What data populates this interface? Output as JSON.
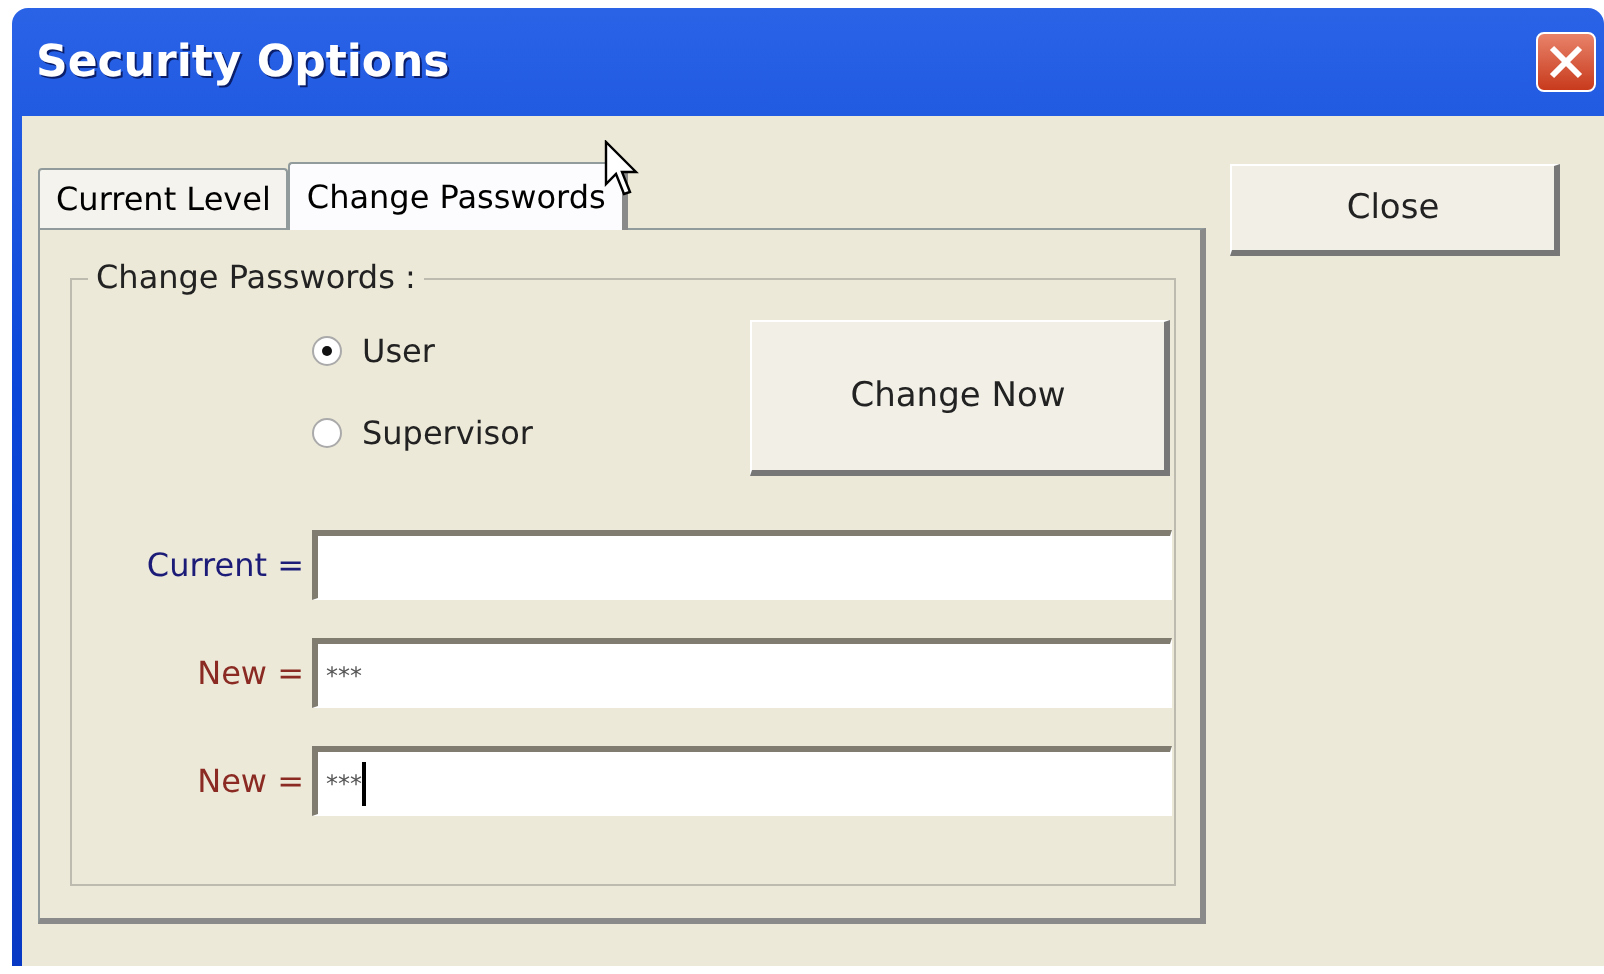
{
  "window": {
    "title": "Security Options"
  },
  "tabs": [
    {
      "label": "Current Level",
      "selected": false
    },
    {
      "label": "Change Passwords",
      "selected": true
    }
  ],
  "group": {
    "title": "Change Passwords :"
  },
  "radios": [
    {
      "label": "User",
      "selected": true
    },
    {
      "label": "Supervisor",
      "selected": false
    }
  ],
  "change_button": "Change Now",
  "fields": [
    {
      "label": "Current =",
      "color": "#1c1c78",
      "focused": false
    },
    {
      "label": "New =",
      "color": "#8a2a22",
      "value": "***",
      "focused": false
    },
    {
      "label": "New =",
      "color": "#8a2a22",
      "value": "***",
      "focused": true
    }
  ],
  "close_button": "Close"
}
